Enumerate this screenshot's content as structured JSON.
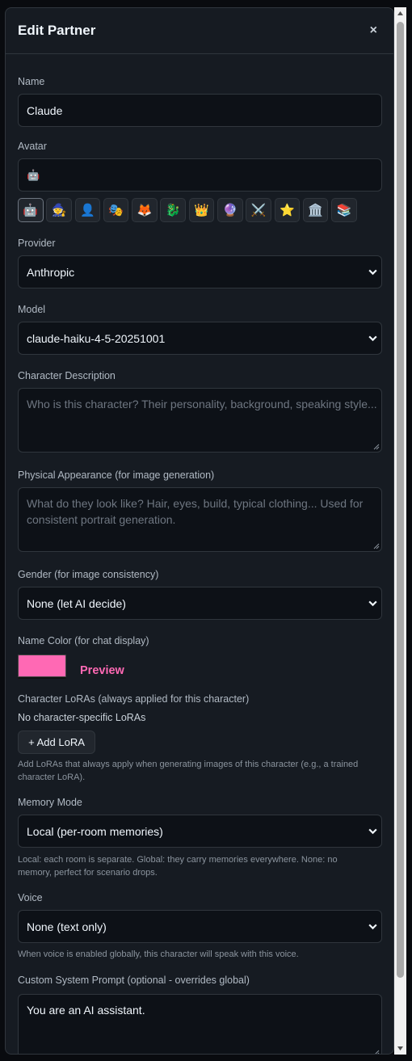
{
  "modal": {
    "title": "Edit Partner",
    "close_label": "×"
  },
  "name": {
    "label": "Name",
    "value": "Claude"
  },
  "avatar": {
    "label": "Avatar",
    "value": "🤖",
    "options": [
      "🤖",
      "🧙",
      "👤",
      "🎭",
      "🦊",
      "🐉",
      "👑",
      "🔮",
      "⚔️",
      "⭐",
      "🏛️",
      "📚"
    ]
  },
  "provider": {
    "label": "Provider",
    "value": "Anthropic"
  },
  "model": {
    "label": "Model",
    "value": "claude-haiku-4-5-20251001"
  },
  "character_description": {
    "label": "Character Description",
    "placeholder": "Who is this character? Their personality, background, speaking style..."
  },
  "physical_appearance": {
    "label": "Physical Appearance (for image generation)",
    "placeholder": "What do they look like? Hair, eyes, build, typical clothing... Used for consistent portrait generation."
  },
  "gender": {
    "label": "Gender (for image consistency)",
    "value": "None (let AI decide)"
  },
  "name_color": {
    "label": "Name Color (for chat display)",
    "value": "#ff69b4",
    "preview": "Preview"
  },
  "loras": {
    "label": "Character LoRAs (always applied for this character)",
    "empty_text": "No character-specific LoRAs",
    "add_label": "+ Add LoRA",
    "hint": "Add LoRAs that always apply when generating images of this character (e.g., a trained character LoRA)."
  },
  "memory_mode": {
    "label": "Memory Mode",
    "value": "Local (per-room memories)",
    "hint": "Local: each room is separate. Global: they carry memories everywhere. None: no memory, perfect for scenario drops."
  },
  "voice": {
    "label": "Voice",
    "value": "None (text only)",
    "hint": "When voice is enabled globally, this character will speak with this voice."
  },
  "system_prompt": {
    "label": "Custom System Prompt (optional - overrides global)",
    "value": "You are an AI assistant."
  }
}
